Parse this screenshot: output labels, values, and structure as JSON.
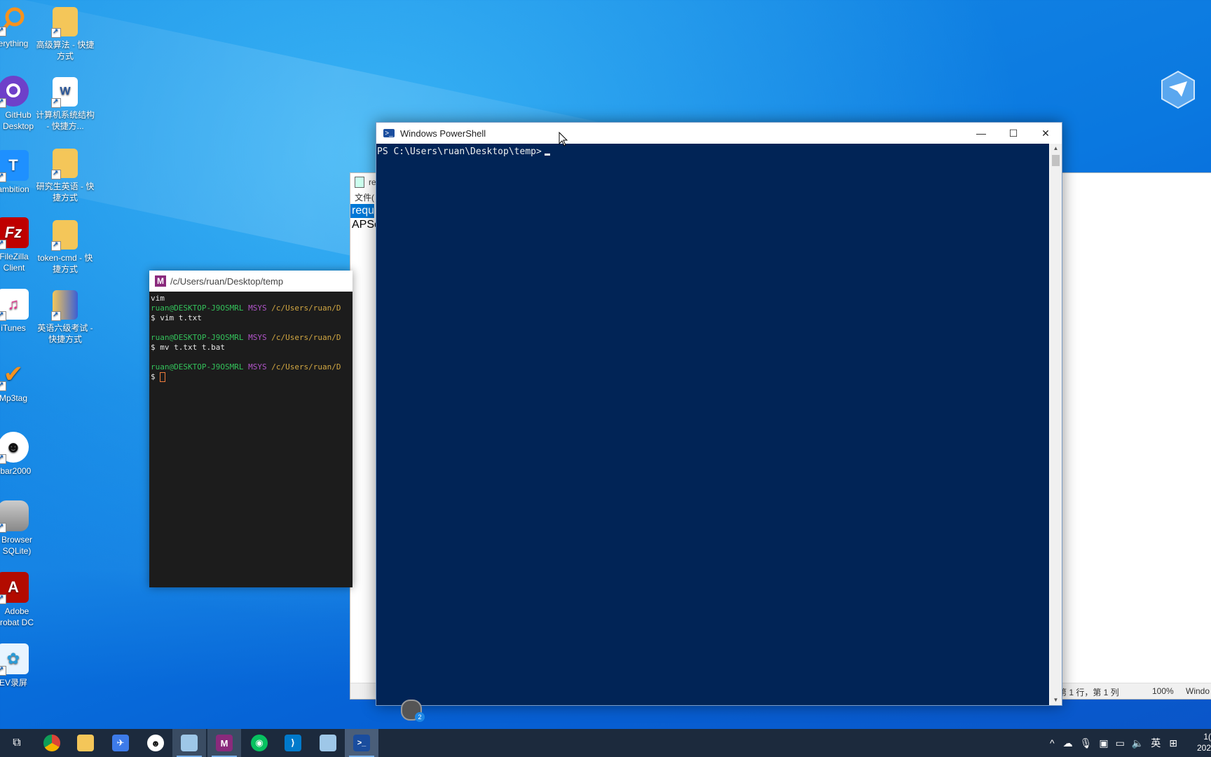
{
  "desktop": {
    "icons_left": [
      {
        "label": "erything"
      },
      {
        "label": "GitHub Desktop"
      },
      {
        "label": "ambition"
      },
      {
        "label": "FileZilla Client"
      },
      {
        "label": "iTunes"
      },
      {
        "label": "Mp3tag"
      },
      {
        "label": "obar2000"
      },
      {
        "label": "Browser SQLite)"
      },
      {
        "label": "Adobe robat DC"
      },
      {
        "label": "EV录屏"
      }
    ],
    "icons_right": [
      {
        "label": "高级算法 - 快捷方式"
      },
      {
        "label": "计算机系统结构 - 快捷方..."
      },
      {
        "label": "研究生英语 - 快捷方式"
      },
      {
        "label": "token-cmd - 快捷方式"
      },
      {
        "label": "英语六级考试 - 快捷方式"
      }
    ]
  },
  "mingw": {
    "title": "/c/Users/ruan/Desktop/temp",
    "logo": "M",
    "line1": "vim",
    "user": "ruan@DESKTOP-J9OSMRL",
    "env": "MSYS",
    "path": "/c/Users/ruan/D",
    "cmd1": "$ vim t.txt",
    "cmd2": "$ mv t.txt t.bat",
    "prompt": "$"
  },
  "notepad": {
    "title": "re",
    "menu": "文件(",
    "line1": "requ",
    "line2": "APSc",
    "status_pos": "第 1 行，第 1 列",
    "status_zoom": "100%",
    "status_enc": "Windo"
  },
  "powershell": {
    "title": "Windows PowerShell",
    "prompt": "PS C:\\Users\\ruan\\Desktop\\temp>",
    "minimize": "—",
    "maximize": "☐",
    "close": "✕",
    "colors": {
      "background": "#012456",
      "text": "#eeeeee"
    }
  },
  "taskbar": {
    "items": [
      "task-view",
      "chrome",
      "file-explorer",
      "feishu",
      "foobar2000",
      "notepad",
      "mingw",
      "wechat",
      "vscode",
      "notepad2",
      "powershell"
    ],
    "tray_lang": "英",
    "tray_up": "^",
    "clock_time": "1(",
    "clock_date": "202"
  },
  "badge_count": "2"
}
